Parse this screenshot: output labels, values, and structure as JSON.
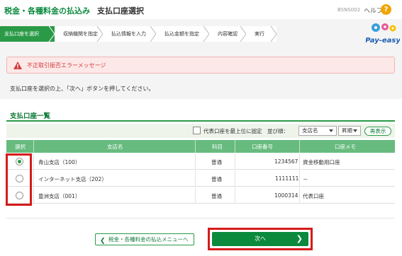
{
  "header": {
    "app_title": "税金・各種料金の払込み",
    "page_title": "支払口座選択",
    "screen_id": "BSNS002",
    "help": "ヘルプ",
    "help_icon": "?"
  },
  "steps": [
    "支払口座を選択",
    "収納機関を指定",
    "払込情報を入力",
    "払込金額を指定",
    "内容確認",
    "実行"
  ],
  "active_step": 0,
  "logo": {
    "text": "Pay-easy",
    "icon": "pay-easy-logo"
  },
  "error": {
    "message": "不正取引振否エラーメッセージ",
    "icon": "warning-icon"
  },
  "instruction": "支払口座を選択の上、「次へ」ボタンを押してください。",
  "account_list": {
    "title": "支払口座一覧",
    "pin_label": "代表口座を最上位に固定",
    "sort_label": "並び順：",
    "sort_field": "支店名",
    "sort_order": "昇順",
    "redisplay": "再表示",
    "columns": [
      "選択",
      "支店名",
      "科目",
      "口座番号",
      "口座メモ"
    ],
    "rows": [
      {
        "selected": true,
        "branch": "青山支店（100）",
        "type": "普通",
        "number": "1234567",
        "memo": "資金移動用口座"
      },
      {
        "selected": false,
        "branch": "インターネット支店（202）",
        "type": "普通",
        "number": "1111111",
        "memo": "－"
      },
      {
        "selected": false,
        "branch": "豊洲支店（001）",
        "type": "普通",
        "number": "1000314",
        "memo": "代表口座"
      }
    ]
  },
  "buttons": {
    "back": "税金・各種料金の払込メニューへ",
    "next": "次へ"
  },
  "colors": {
    "brand_green": "#0b8a3e",
    "header_green": "#67bb7e",
    "error_red": "#d23a3a",
    "highlight": "#d61b1b"
  }
}
